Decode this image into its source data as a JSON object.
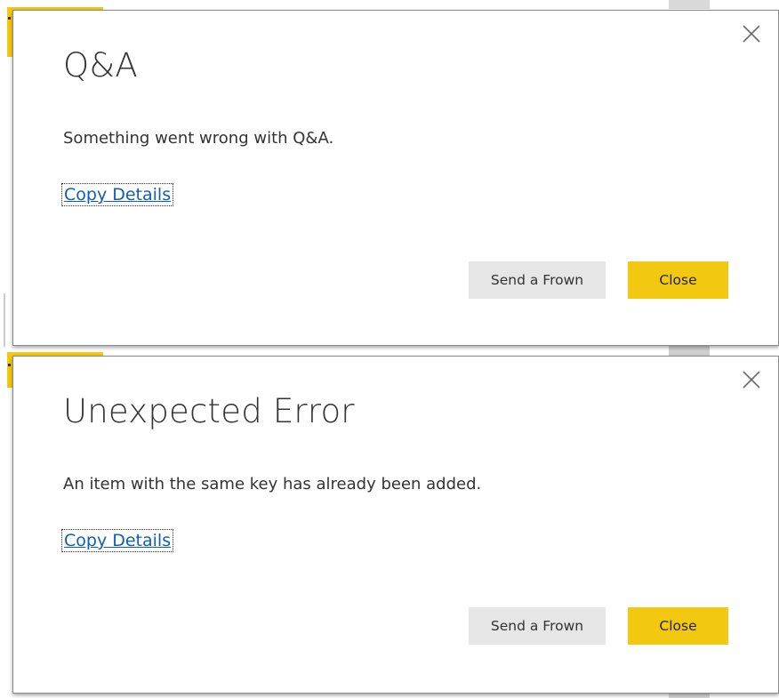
{
  "dialogs": [
    {
      "title": "Q&A",
      "message": "Something went wrong with Q&A.",
      "link_label": "Copy Details",
      "secondary_button": "Send a Frown",
      "primary_button": "Close"
    },
    {
      "title": "Unexpected Error",
      "message": "An item with the same key has already been added.",
      "link_label": "Copy Details",
      "secondary_button": "Send a Frown",
      "primary_button": "Close"
    }
  ],
  "colors": {
    "accent_yellow": "#f2c811",
    "secondary_button_bg": "#e6e6e6",
    "link": "#0f5fb5",
    "text": "#333333"
  },
  "icons": {
    "close": "close-icon"
  }
}
